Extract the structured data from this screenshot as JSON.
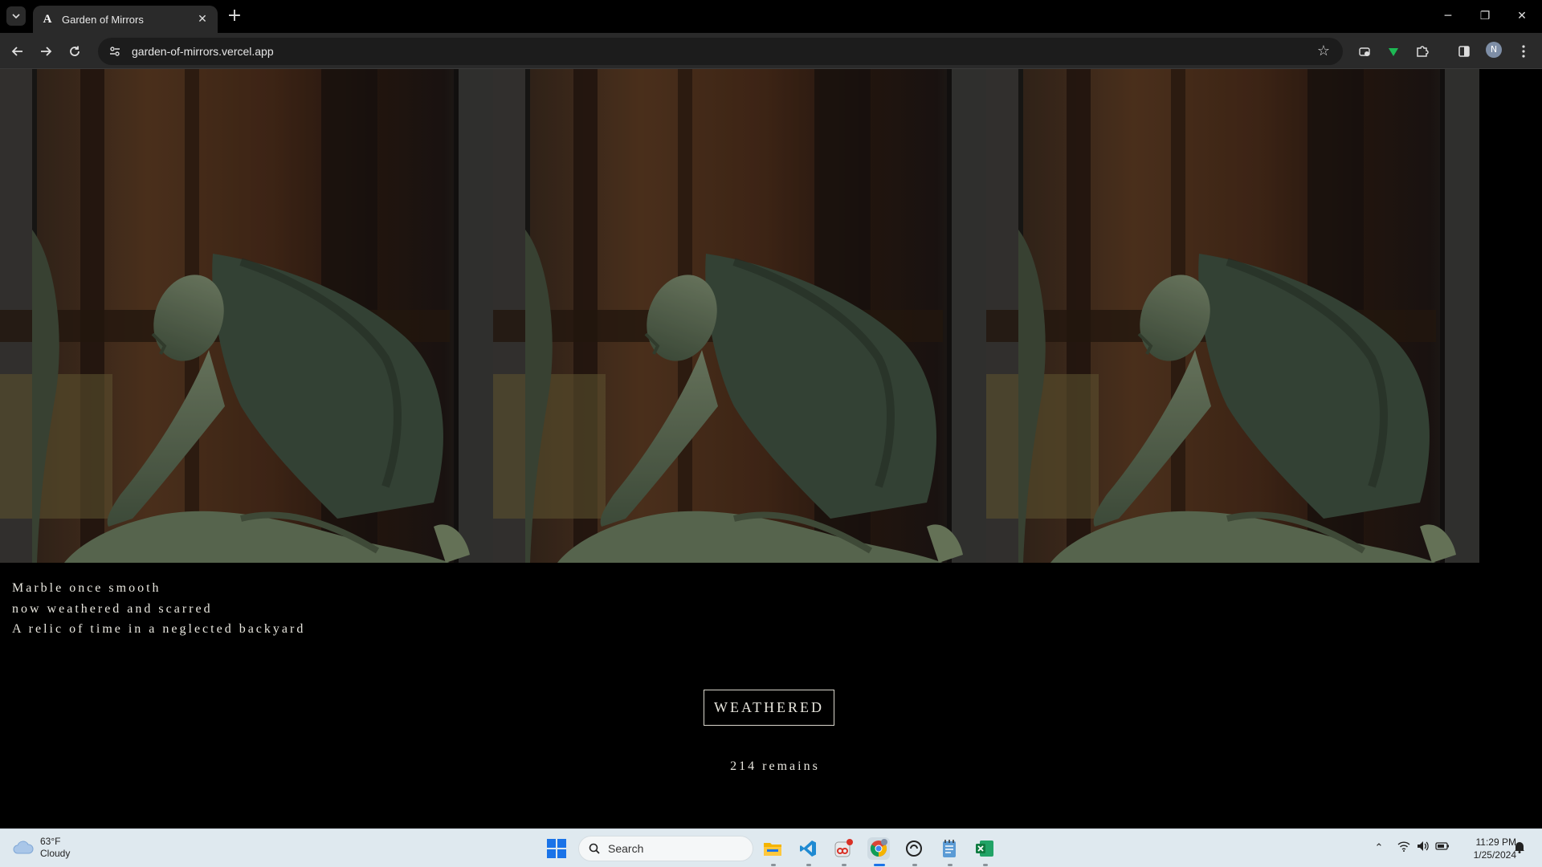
{
  "browser": {
    "tab_title": "Garden of Mirrors",
    "tab_favicon": "A",
    "url": "garden-of-mirrors.vercel.app",
    "profile_initial": "N"
  },
  "page": {
    "poem_lines": [
      "Marble once smooth",
      "now weathered and scarred",
      "A relic of time in a neglected backyard"
    ],
    "title_button": "WEATHERED",
    "remains_text": "214 remains",
    "image_panels": 3
  },
  "taskbar": {
    "weather_temp": "63°F",
    "weather_desc": "Cloudy",
    "search_placeholder": "Search",
    "time": "11:29 PM",
    "date": "1/25/2024",
    "apps": [
      "file-explorer",
      "vscode",
      "snipping-tool",
      "chrome",
      "clipchamp",
      "notepad",
      "excel"
    ]
  },
  "colors": {
    "page_bg": "#000000",
    "text": "#e8e6de",
    "chrome_bg": "#2a2a2a",
    "taskbar_bg": "#dfe9ef"
  }
}
